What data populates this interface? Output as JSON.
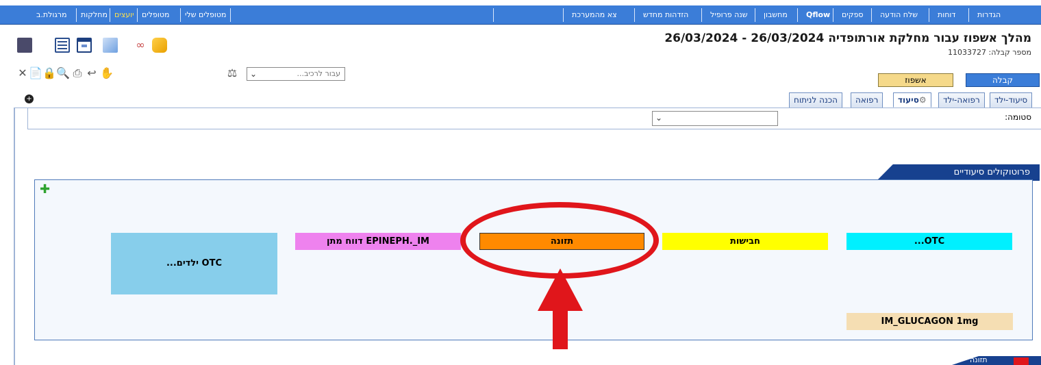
{
  "menubar": {
    "items": [
      {
        "label": "הגדרות"
      },
      {
        "label": "דוחות"
      },
      {
        "label": "שלח הודעה"
      },
      {
        "label": "ספקים"
      },
      {
        "label": "Qflow"
      },
      {
        "label": "מחשבון"
      },
      {
        "label": "שנה פרופיל"
      },
      {
        "label": "הזדהות מחדש"
      },
      {
        "label": "צא מהמערכת"
      }
    ],
    "left_items": [
      {
        "label": "מטופלים שלי"
      },
      {
        "label": "מטופלים"
      },
      {
        "label": "יועצים"
      },
      {
        "label": "מחלקות"
      },
      {
        "label": "מרגולת.ב"
      }
    ]
  },
  "header": {
    "title": "מהלך אשפוז עבור מחלקת אורתופדיה 26/03/2024 - 26/03/2024",
    "record_number": "מספר קבלה: 11033727"
  },
  "buttons": {
    "kabala": "קבלה",
    "ishpuz": "אשפוז"
  },
  "toolbar": {
    "goto_placeholder": "...עבור לרכיב"
  },
  "tabs": [
    {
      "label": "סיעוד-ילד"
    },
    {
      "label": "רפואה-ילד"
    },
    {
      "label": "סיעוד"
    },
    {
      "label": "רפואה"
    },
    {
      "label": "הכנה לניתוח"
    }
  ],
  "form": {
    "stoma_label": "סטומה:"
  },
  "protocols": {
    "title": "פרוטוקולים סיעודיים",
    "items": [
      {
        "label": "...OTC",
        "color": "#00f0ff"
      },
      {
        "label": "חבישות",
        "color": "#ffff00"
      },
      {
        "label": "תזונה",
        "color": "#ff8a00"
      },
      {
        "label": "EPINEPH._IM דווח מתן",
        "color": "#ee82ee"
      },
      {
        "label": "OTC ילדים...",
        "color": "#87ceeb"
      },
      {
        "label": "IM_GLUCAGON 1mg",
        "color": "#f5deb3"
      }
    ]
  },
  "bottom_section": {
    "label": "תזונה"
  }
}
